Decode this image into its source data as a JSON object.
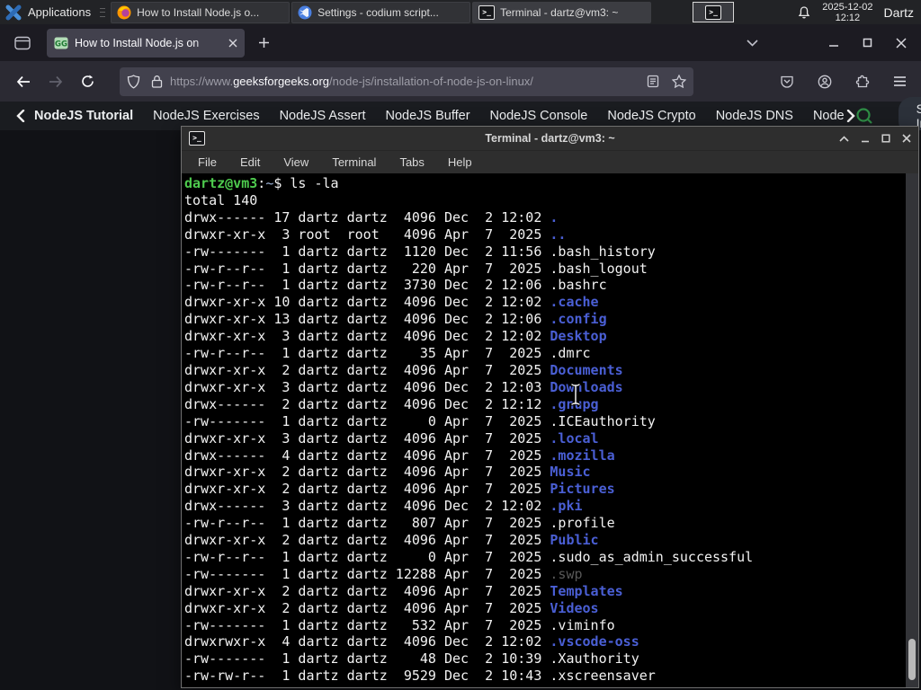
{
  "panel": {
    "applications_label": "Applications",
    "window_buttons": [
      {
        "icon": "firefox-icon",
        "title": "How to Install Node.js o..."
      },
      {
        "icon": "codium-icon",
        "title": "Settings - codium script..."
      },
      {
        "icon": "terminal-icon",
        "title": "Terminal - dartz@vm3: ~"
      }
    ],
    "clock": {
      "date": "2025-12-02",
      "time": "12:12"
    },
    "user_label": "Dartz"
  },
  "browser": {
    "tab": {
      "title": "How to Install Node.js on"
    },
    "url": {
      "scheme": "https://www.",
      "domain": "geeksforgeeks.org",
      "path": "/node-js/installation-of-node-js-on-linux/"
    },
    "nav_items": [
      "NodeJS Tutorial",
      "NodeJS Exercises",
      "NodeJS Assert",
      "NodeJS Buffer",
      "NodeJS Console",
      "NodeJS Crypto",
      "NodeJS DNS",
      "Node"
    ],
    "sign_in_label": "Sign In"
  },
  "terminal_window": {
    "title": "Terminal - dartz@vm3: ~",
    "menu_items": [
      "File",
      "Edit",
      "View",
      "Terminal",
      "Tabs",
      "Help"
    ],
    "lines": [
      [
        {
          "t": "dartz@vm3",
          "c": "g"
        },
        {
          "t": ":",
          "c": "w"
        },
        {
          "t": "~",
          "c": "b2"
        },
        {
          "t": "$ ls -la",
          "c": "w"
        }
      ],
      [
        {
          "t": "total 140",
          "c": "w"
        }
      ],
      [
        {
          "t": "drwx------ 17 dartz dartz  4096 Dec  2 12:02 ",
          "c": "w"
        },
        {
          "t": ".",
          "c": "d"
        }
      ],
      [
        {
          "t": "drwxr-xr-x  3 root  root   4096 Apr  7  2025 ",
          "c": "w"
        },
        {
          "t": "..",
          "c": "d"
        }
      ],
      [
        {
          "t": "-rw-------  1 dartz dartz  1120 Dec  2 11:56 .bash_history",
          "c": "w"
        }
      ],
      [
        {
          "t": "-rw-r--r--  1 dartz dartz   220 Apr  7  2025 .bash_logout",
          "c": "w"
        }
      ],
      [
        {
          "t": "-rw-r--r--  1 dartz dartz  3730 Dec  2 12:06 .bashrc",
          "c": "w"
        }
      ],
      [
        {
          "t": "drwxr-xr-x 10 dartz dartz  4096 Dec  2 12:02 ",
          "c": "w"
        },
        {
          "t": ".cache",
          "c": "d"
        }
      ],
      [
        {
          "t": "drwxr-xr-x 13 dartz dartz  4096 Dec  2 12:06 ",
          "c": "w"
        },
        {
          "t": ".config",
          "c": "d"
        }
      ],
      [
        {
          "t": "drwxr-xr-x  3 dartz dartz  4096 Dec  2 12:02 ",
          "c": "w"
        },
        {
          "t": "Desktop",
          "c": "d"
        }
      ],
      [
        {
          "t": "-rw-r--r--  1 dartz dartz    35 Apr  7  2025 .dmrc",
          "c": "w"
        }
      ],
      [
        {
          "t": "drwxr-xr-x  2 dartz dartz  4096 Apr  7  2025 ",
          "c": "w"
        },
        {
          "t": "Documents",
          "c": "d"
        }
      ],
      [
        {
          "t": "drwxr-xr-x  3 dartz dartz  4096 Dec  2 12:03 ",
          "c": "w"
        },
        {
          "t": "Downloads",
          "c": "d"
        }
      ],
      [
        {
          "t": "drwx------  2 dartz dartz  4096 Dec  2 12:12 ",
          "c": "w"
        },
        {
          "t": ".gnupg",
          "c": "d"
        }
      ],
      [
        {
          "t": "-rw-------  1 dartz dartz     0 Apr  7  2025 .ICEauthority",
          "c": "w"
        }
      ],
      [
        {
          "t": "drwxr-xr-x  3 dartz dartz  4096 Apr  7  2025 ",
          "c": "w"
        },
        {
          "t": ".local",
          "c": "d"
        }
      ],
      [
        {
          "t": "drwx------  4 dartz dartz  4096 Apr  7  2025 ",
          "c": "w"
        },
        {
          "t": ".mozilla",
          "c": "d"
        }
      ],
      [
        {
          "t": "drwxr-xr-x  2 dartz dartz  4096 Apr  7  2025 ",
          "c": "w"
        },
        {
          "t": "Music",
          "c": "d"
        }
      ],
      [
        {
          "t": "drwxr-xr-x  2 dartz dartz  4096 Apr  7  2025 ",
          "c": "w"
        },
        {
          "t": "Pictures",
          "c": "d"
        }
      ],
      [
        {
          "t": "drwx------  3 dartz dartz  4096 Dec  2 12:02 ",
          "c": "w"
        },
        {
          "t": ".pki",
          "c": "d"
        }
      ],
      [
        {
          "t": "-rw-r--r--  1 dartz dartz   807 Apr  7  2025 .profile",
          "c": "w"
        }
      ],
      [
        {
          "t": "drwxr-xr-x  2 dartz dartz  4096 Apr  7  2025 ",
          "c": "w"
        },
        {
          "t": "Public",
          "c": "d"
        }
      ],
      [
        {
          "t": "-rw-r--r--  1 dartz dartz     0 Apr  7  2025 .sudo_as_admin_successful",
          "c": "w"
        }
      ],
      [
        {
          "t": "-rw-------  1 dartz dartz 12288 Apr  7  2025 ",
          "c": "w"
        },
        {
          "t": ".swp",
          "c": "dim"
        }
      ],
      [
        {
          "t": "drwxr-xr-x  2 dartz dartz  4096 Apr  7  2025 ",
          "c": "w"
        },
        {
          "t": "Templates",
          "c": "d"
        }
      ],
      [
        {
          "t": "drwxr-xr-x  2 dartz dartz  4096 Apr  7  2025 ",
          "c": "w"
        },
        {
          "t": "Videos",
          "c": "d"
        }
      ],
      [
        {
          "t": "-rw-------  1 dartz dartz   532 Apr  7  2025 .viminfo",
          "c": "w"
        }
      ],
      [
        {
          "t": "drwxrwxr-x  4 dartz dartz  4096 Dec  2 12:02 ",
          "c": "w"
        },
        {
          "t": ".vscode-oss",
          "c": "d"
        }
      ],
      [
        {
          "t": "-rw-------  1 dartz dartz    48 Dec  2 10:39 .Xauthority",
          "c": "w"
        }
      ],
      [
        {
          "t": "-rw-rw-r--  1 dartz dartz  9529 Dec  2 10:43 .xscreensaver",
          "c": "w"
        }
      ]
    ]
  },
  "colors": {
    "gfg_green": "#2f8d46",
    "dir_blue": "#4a5fd5",
    "prompt_green": "#4ecb4e",
    "firefox_orange": "#ff9500",
    "codium_blue": "#4a7fe0",
    "panel_bg": "#222326",
    "terminal_bg": "#000000"
  }
}
